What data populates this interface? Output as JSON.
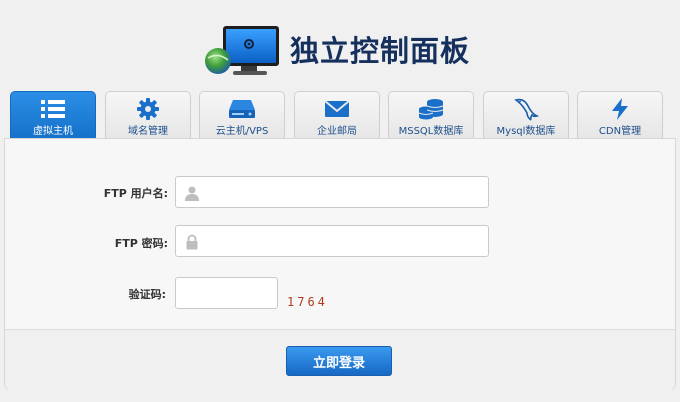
{
  "header": {
    "title": "独立控制面板",
    "logo_icon": "monitor-globe-icon"
  },
  "tabs": [
    {
      "label": "虚拟主机",
      "icon": "list-icon",
      "active": true
    },
    {
      "label": "域名管理",
      "icon": "gear-icon",
      "active": false
    },
    {
      "label": "云主机/VPS",
      "icon": "server-drive-icon",
      "active": false
    },
    {
      "label": "企业邮局",
      "icon": "envelope-icon",
      "active": false
    },
    {
      "label": "MSSQL数据库",
      "icon": "database-icon",
      "active": false
    },
    {
      "label": "Mysql数据库",
      "icon": "dolphin-icon",
      "active": false
    },
    {
      "label": "CDN管理",
      "icon": "lightning-icon",
      "active": false
    }
  ],
  "form": {
    "username_label": "FTP 用户名:",
    "username_value": "",
    "password_label": "FTP 密码:",
    "password_value": "",
    "captcha_label": "验证码:",
    "captcha_value": "",
    "captcha_code": "1764",
    "submit_label": "立即登录"
  },
  "colors": {
    "accent": "#1a7fdc",
    "title": "#16305e",
    "captcha": "#b33a1e"
  }
}
